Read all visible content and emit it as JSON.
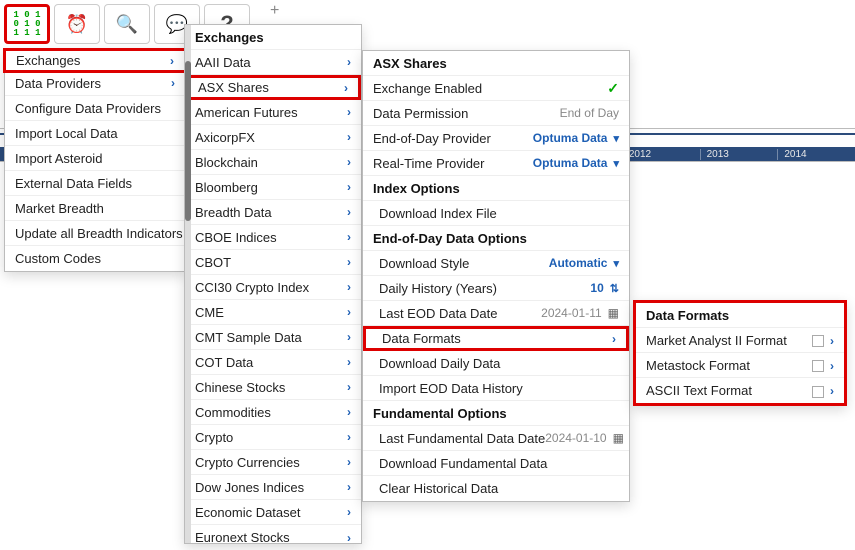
{
  "toolbar": {
    "matrix": "1 0 1\n0 1 0\n1 1 1",
    "icons": [
      "alarm",
      "search",
      "chat",
      "help"
    ]
  },
  "plus": "+",
  "panel1": {
    "items": [
      {
        "label": "Exchanges",
        "arrow": true,
        "highlight": true
      },
      {
        "label": "Data Providers",
        "arrow": true
      },
      {
        "label": "Configure Data Providers"
      },
      {
        "label": "Import Local Data"
      },
      {
        "label": "Import Asteroid"
      },
      {
        "label": "External Data Fields"
      },
      {
        "label": "Market Breadth"
      },
      {
        "label": "Update all Breadth Indicators"
      },
      {
        "label": "Custom Codes"
      }
    ]
  },
  "panel2": {
    "header": "Exchanges",
    "items": [
      {
        "label": "AAII Data"
      },
      {
        "label": "ASX Shares",
        "highlight": true
      },
      {
        "label": "American Futures"
      },
      {
        "label": "AxicorpFX"
      },
      {
        "label": "Blockchain"
      },
      {
        "label": "Bloomberg"
      },
      {
        "label": "Breadth Data"
      },
      {
        "label": "CBOE Indices"
      },
      {
        "label": "CBOT"
      },
      {
        "label": "CCI30 Crypto Index"
      },
      {
        "label": "CME"
      },
      {
        "label": "CMT Sample Data"
      },
      {
        "label": "COT Data"
      },
      {
        "label": "Chinese Stocks"
      },
      {
        "label": "Commodities"
      },
      {
        "label": "Crypto"
      },
      {
        "label": "Crypto Currencies"
      },
      {
        "label": "Dow Jones Indices"
      },
      {
        "label": "Economic Dataset"
      },
      {
        "label": "Euronext Stocks"
      }
    ]
  },
  "panel3": {
    "title": "ASX Shares",
    "rows": [
      {
        "type": "kv",
        "k": "Exchange Enabled",
        "v": "✓",
        "tick": true
      },
      {
        "type": "kv",
        "k": "Data Permission",
        "v": "End of Day"
      },
      {
        "type": "kv",
        "k": "End-of-Day Provider",
        "v": "Optuma Data",
        "dd": true
      },
      {
        "type": "kv",
        "k": "Real-Time Provider",
        "v": "Optuma Data",
        "dd": true
      },
      {
        "type": "hdr",
        "k": "Index Options"
      },
      {
        "type": "sub",
        "k": "Download Index File"
      },
      {
        "type": "hdr",
        "k": "End-of-Day Data Options"
      },
      {
        "type": "kvs",
        "k": "Download Style",
        "v": "Automatic",
        "dd": true
      },
      {
        "type": "kvs",
        "k": "Daily History (Years)",
        "v": "10",
        "spn": true
      },
      {
        "type": "kvs",
        "k": "Last EOD Data Date",
        "v": "2024-01-11",
        "cal": true
      },
      {
        "type": "kvs",
        "k": "Data Formats",
        "arrow": true,
        "highlight": true
      },
      {
        "type": "sub",
        "k": "Download Daily Data"
      },
      {
        "type": "sub",
        "k": "Import EOD Data History"
      },
      {
        "type": "hdr",
        "k": "Fundamental Options"
      },
      {
        "type": "kvs",
        "k": "Last Fundamental Data Date",
        "v": "2024-01-10",
        "cal": true
      },
      {
        "type": "sub",
        "k": "Download Fundamental Data"
      },
      {
        "type": "sub",
        "k": "Clear Historical Data"
      }
    ]
  },
  "panel4": {
    "header": "Data Formats",
    "items": [
      {
        "label": "Market Analyst II Format"
      },
      {
        "label": "Metastock Format"
      },
      {
        "label": "ASCII Text Format"
      }
    ]
  },
  "timeline": {
    "years": [
      "",
      "",
      "",
      "",
      "",
      "",
      "",
      "",
      "2012",
      "2013",
      "2014"
    ]
  }
}
